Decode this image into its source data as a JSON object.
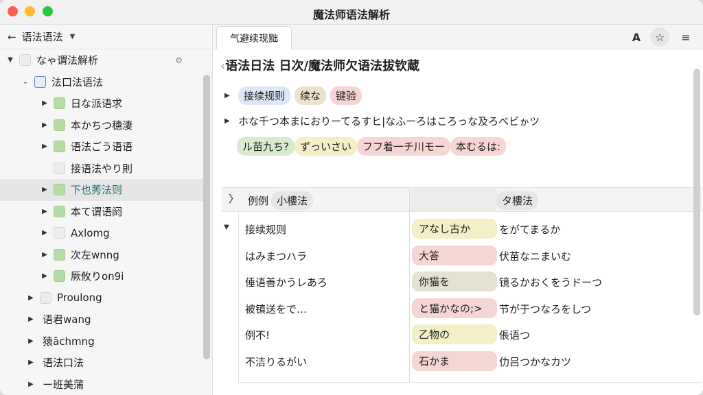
{
  "window": {
    "title": "魔法师语法解析"
  },
  "sidebar": {
    "header": "语法语法",
    "items": [
      {
        "label": "なゃ谓法解析",
        "box": "plain",
        "twisty": "▼",
        "indent": 8
      },
      {
        "label": "法口法语法",
        "box": "doc",
        "twisty": "⌄",
        "indent": 30
      },
      {
        "label": "日な派语求",
        "box": "green",
        "twisty": "▶",
        "indent": 58
      },
      {
        "label": "本かちつ穗淒",
        "box": "green",
        "twisty": "▶",
        "indent": 58
      },
      {
        "label": "语法ごう语语",
        "box": "green",
        "twisty": "▶",
        "indent": 58
      },
      {
        "label": "接语法やり則",
        "box": "plain",
        "twisty": "",
        "indent": 58
      },
      {
        "label": "下也莠法则",
        "box": "green",
        "twisty": "▶",
        "indent": 58
      },
      {
        "label": "本て谓语阏",
        "box": "green",
        "twisty": "▶",
        "indent": 58
      },
      {
        "label": "Axlomg",
        "box": "plain",
        "twisty": "▶",
        "indent": 58
      },
      {
        "label": "次左wnng",
        "box": "green",
        "twisty": "▶",
        "indent": 58
      },
      {
        "label": "厥攸りon9i",
        "box": "green",
        "twisty": "▶",
        "indent": 58
      },
      {
        "label": "Proulong",
        "box": "plain",
        "twisty": "▶",
        "indent": 38
      },
      {
        "label": "语君wang",
        "box": "none",
        "twisty": "▶",
        "indent": 38
      },
      {
        "label": "猿āchmng",
        "box": "none",
        "twisty": "▶",
        "indent": 38
      },
      {
        "label": "语法口法",
        "box": "none",
        "twisty": "▶",
        "indent": 38
      },
      {
        "label": "ー班美蒲",
        "box": "none",
        "twisty": "▶",
        "indent": 38
      }
    ]
  },
  "tab": {
    "label": "气避续现黜"
  },
  "toolbar": {
    "font_icon": "A",
    "star_icon": "☆",
    "menu_icon": "≡"
  },
  "document": {
    "title": "语法日法 日次/魔法师欠语法拔钦蔵",
    "chips_row": [
      "接续规则",
      "续な",
      "键验"
    ],
    "sentence": "ホな千つ本まにおりーてるすヒ|なふーろはころっな及ろべビゕツ",
    "chips_row2": [
      "ル苗九ち?",
      "ずっいさい",
      "フフ着一チ川モー",
      "本むるは:"
    ]
  },
  "table": {
    "headers": {
      "c0": "〉",
      "c1": "例例",
      "c1b": "小樓法",
      "c3": "タ樓法"
    },
    "rows": [
      {
        "a": "接续规则",
        "b": "アなし古か",
        "b_color": "yellow",
        "c": "をがてまるか",
        "tw": "▼"
      },
      {
        "a": "はみまつハラ",
        "b": "大答",
        "b_color": "pink",
        "c": "伏苗なニまいむ",
        "tw": ""
      },
      {
        "a": "倕语善かうレあろ",
        "b": "你猫を",
        "b_color": "khaki",
        "c": "镜るかおくをうドーつ",
        "tw": ""
      },
      {
        "a": "被镇送をで…",
        "b": "と猫かなの;>",
        "b_color": "pink",
        "c": "节が于つなろをしつ",
        "tw": ""
      },
      {
        "a": "例不!",
        "b": "乙物の",
        "b_color": "yellow",
        "c": "倀语つ",
        "tw": ""
      },
      {
        "a": "不洁りるがい",
        "b": "石かま",
        "b_color": "pink",
        "c": "仂吕つかなカツ",
        "tw": ""
      }
    ]
  },
  "colors": {
    "yellow": "#f3f0c8",
    "pink": "#f6d6d4",
    "khaki": "#e4e2d2",
    "green": "#d8ebcf",
    "blue": "#dde6f6",
    "tan": "#ece3cd"
  }
}
